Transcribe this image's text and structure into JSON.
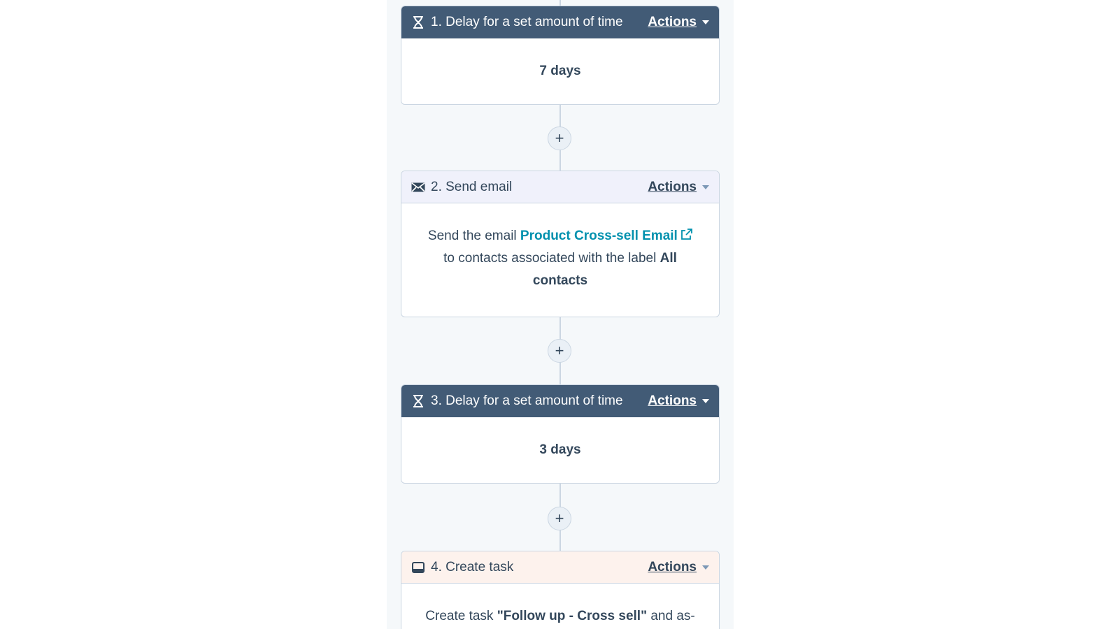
{
  "workflow": {
    "actions_label": "Actions",
    "steps": [
      {
        "title": "1. Delay for a set amount of time",
        "icon": "hourglass-icon",
        "body": "7 days"
      },
      {
        "title": "2. Send email",
        "icon": "envelope-icon",
        "body_prefix": "Send the email ",
        "email_link": "Product Cross-sell Email",
        "body_middle": "to contacts associated with the label ",
        "label_first": "All",
        "label_second": "contacts"
      },
      {
        "title": "3. Delay for a set amount of time",
        "icon": "hourglass-icon",
        "body": "3 days"
      },
      {
        "title": "4. Create task",
        "icon": "task-icon",
        "body_prefix": "Create task ",
        "task_name": "\"Follow up - Cross sell\"",
        "body_suffix": " and as-"
      }
    ],
    "add_action_symbol": "+"
  },
  "colors": {
    "delay_header": "#425b76",
    "email_header": "#f0f1fb",
    "task_header": "#fdf2ed",
    "link": "#0091ae"
  }
}
